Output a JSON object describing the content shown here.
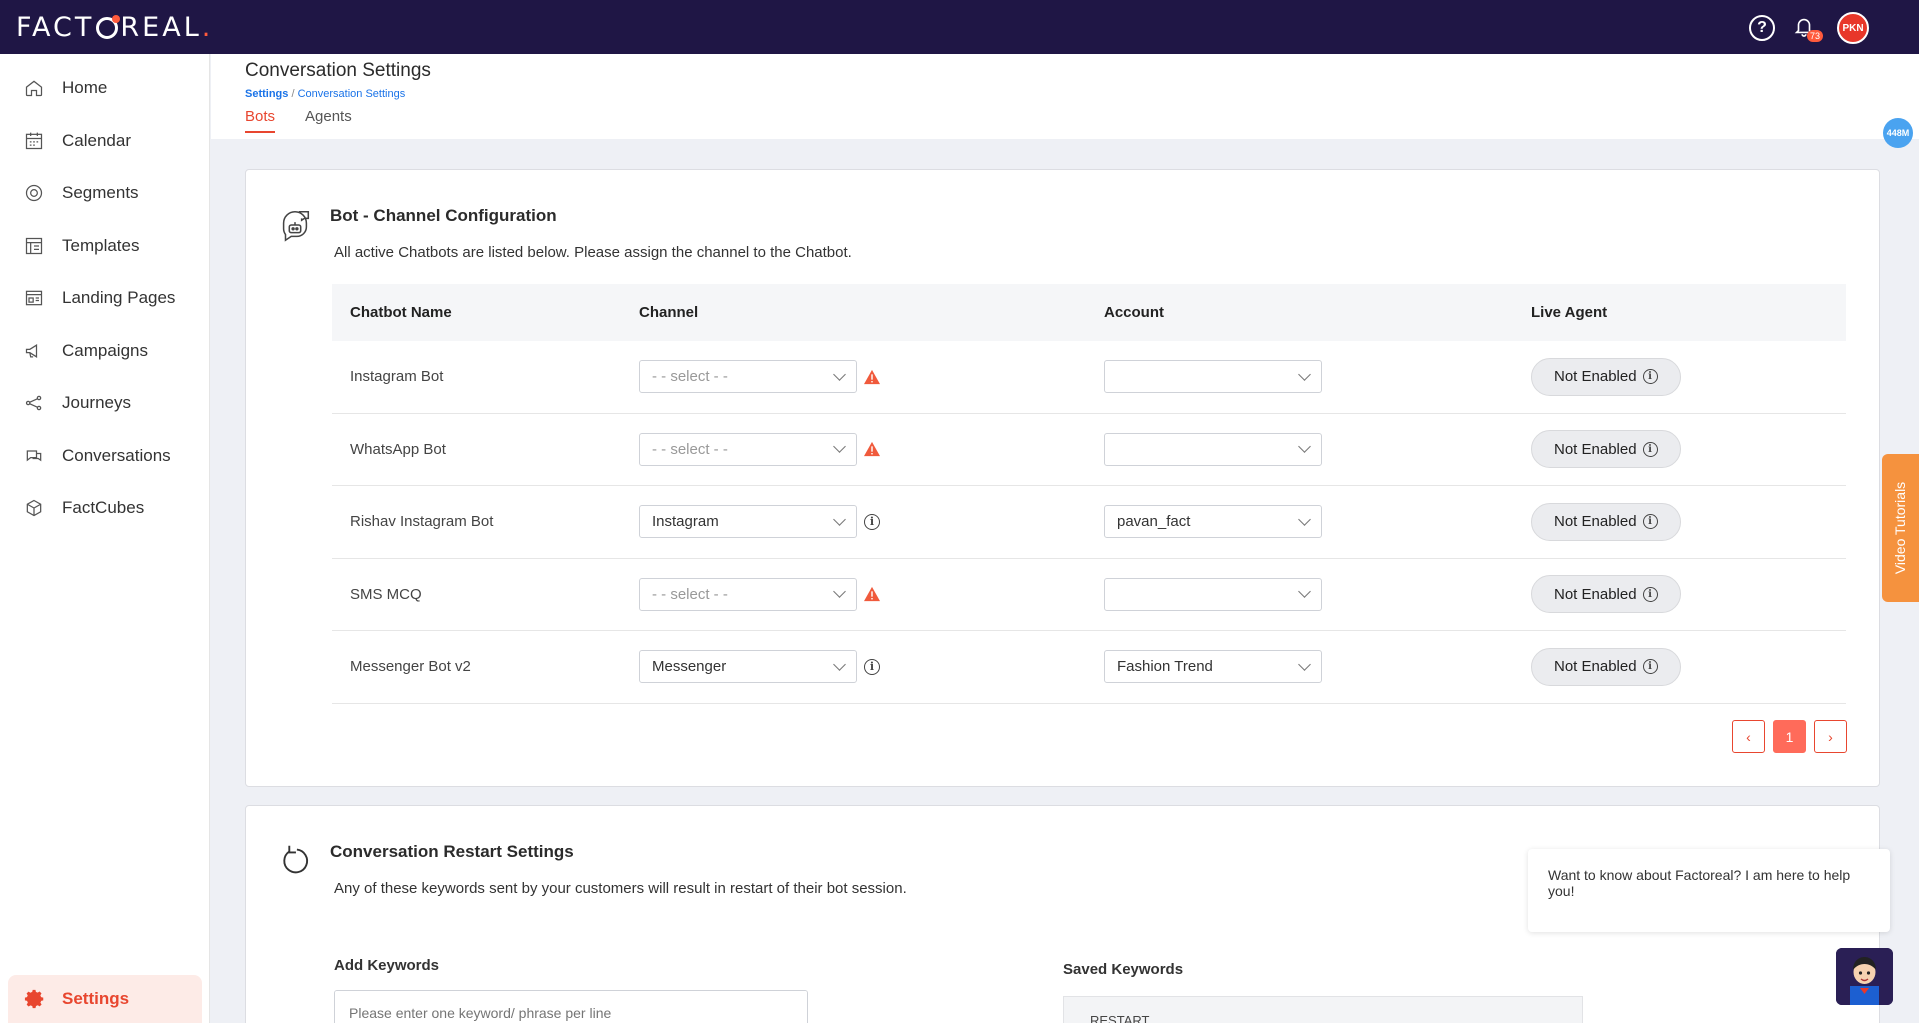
{
  "app": {
    "logo_text": "FACTOREAL",
    "notification_count": "73",
    "user_initials": "PKN",
    "memory_badge": "448M"
  },
  "sidebar": {
    "items": [
      {
        "label": "Home",
        "icon": "home-icon"
      },
      {
        "label": "Calendar",
        "icon": "calendar-icon"
      },
      {
        "label": "Segments",
        "icon": "segments-icon"
      },
      {
        "label": "Templates",
        "icon": "templates-icon"
      },
      {
        "label": "Landing Pages",
        "icon": "landing-pages-icon"
      },
      {
        "label": "Campaigns",
        "icon": "megaphone-icon"
      },
      {
        "label": "Journeys",
        "icon": "journeys-icon"
      },
      {
        "label": "Conversations",
        "icon": "conversations-icon"
      },
      {
        "label": "FactCubes",
        "icon": "cube-icon"
      }
    ],
    "settings_label": "Settings"
  },
  "header": {
    "title": "Conversation Settings",
    "breadcrumb_root": "Settings",
    "breadcrumb_sep": " / ",
    "breadcrumb_current": "Conversation Settings",
    "tabs": [
      {
        "label": "Bots",
        "active": true
      },
      {
        "label": "Agents",
        "active": false
      }
    ]
  },
  "bot_config": {
    "title": "Bot - Channel Configuration",
    "description": "All active Chatbots are listed below. Please assign the channel to the Chatbot.",
    "columns": [
      "Chatbot Name",
      "Channel",
      "Account",
      "Live Agent"
    ],
    "rows": [
      {
        "name": "Instagram Bot",
        "channel": "- - select - -",
        "channel_set": false,
        "account": "",
        "live_agent": "Not Enabled"
      },
      {
        "name": "WhatsApp Bot",
        "channel": "- - select - -",
        "channel_set": false,
        "account": "",
        "live_agent": "Not Enabled"
      },
      {
        "name": "Rishav Instagram Bot",
        "channel": "Instagram",
        "channel_set": true,
        "account": "pavan_fact",
        "live_agent": "Not Enabled"
      },
      {
        "name": "SMS MCQ",
        "channel": "- - select - -",
        "channel_set": false,
        "account": "",
        "live_agent": "Not Enabled"
      },
      {
        "name": "Messenger Bot v2",
        "channel": "Messenger",
        "channel_set": true,
        "account": "Fashion Trend",
        "live_agent": "Not Enabled"
      }
    ],
    "pagination": {
      "prev": "‹",
      "current": "1",
      "next": "›"
    }
  },
  "restart_settings": {
    "title": "Conversation Restart Settings",
    "description": "Any of these keywords sent by your customers will result in restart of their bot session.",
    "add_label": "Add Keywords",
    "input_placeholder": "Please enter one keyword/ phrase per line",
    "saved_label": "Saved Keywords",
    "saved_keywords": [
      "RESTART"
    ]
  },
  "video_tutorials": "Video Tutorials",
  "chat_widget": {
    "message": "Want to know about Factoreal? I am here to help you!"
  },
  "colors": {
    "topbar": "#1f1645",
    "accent": "#e8462f",
    "link": "#1a73e8",
    "warning": "#f05a3c",
    "video_tab": "#f5923e"
  }
}
